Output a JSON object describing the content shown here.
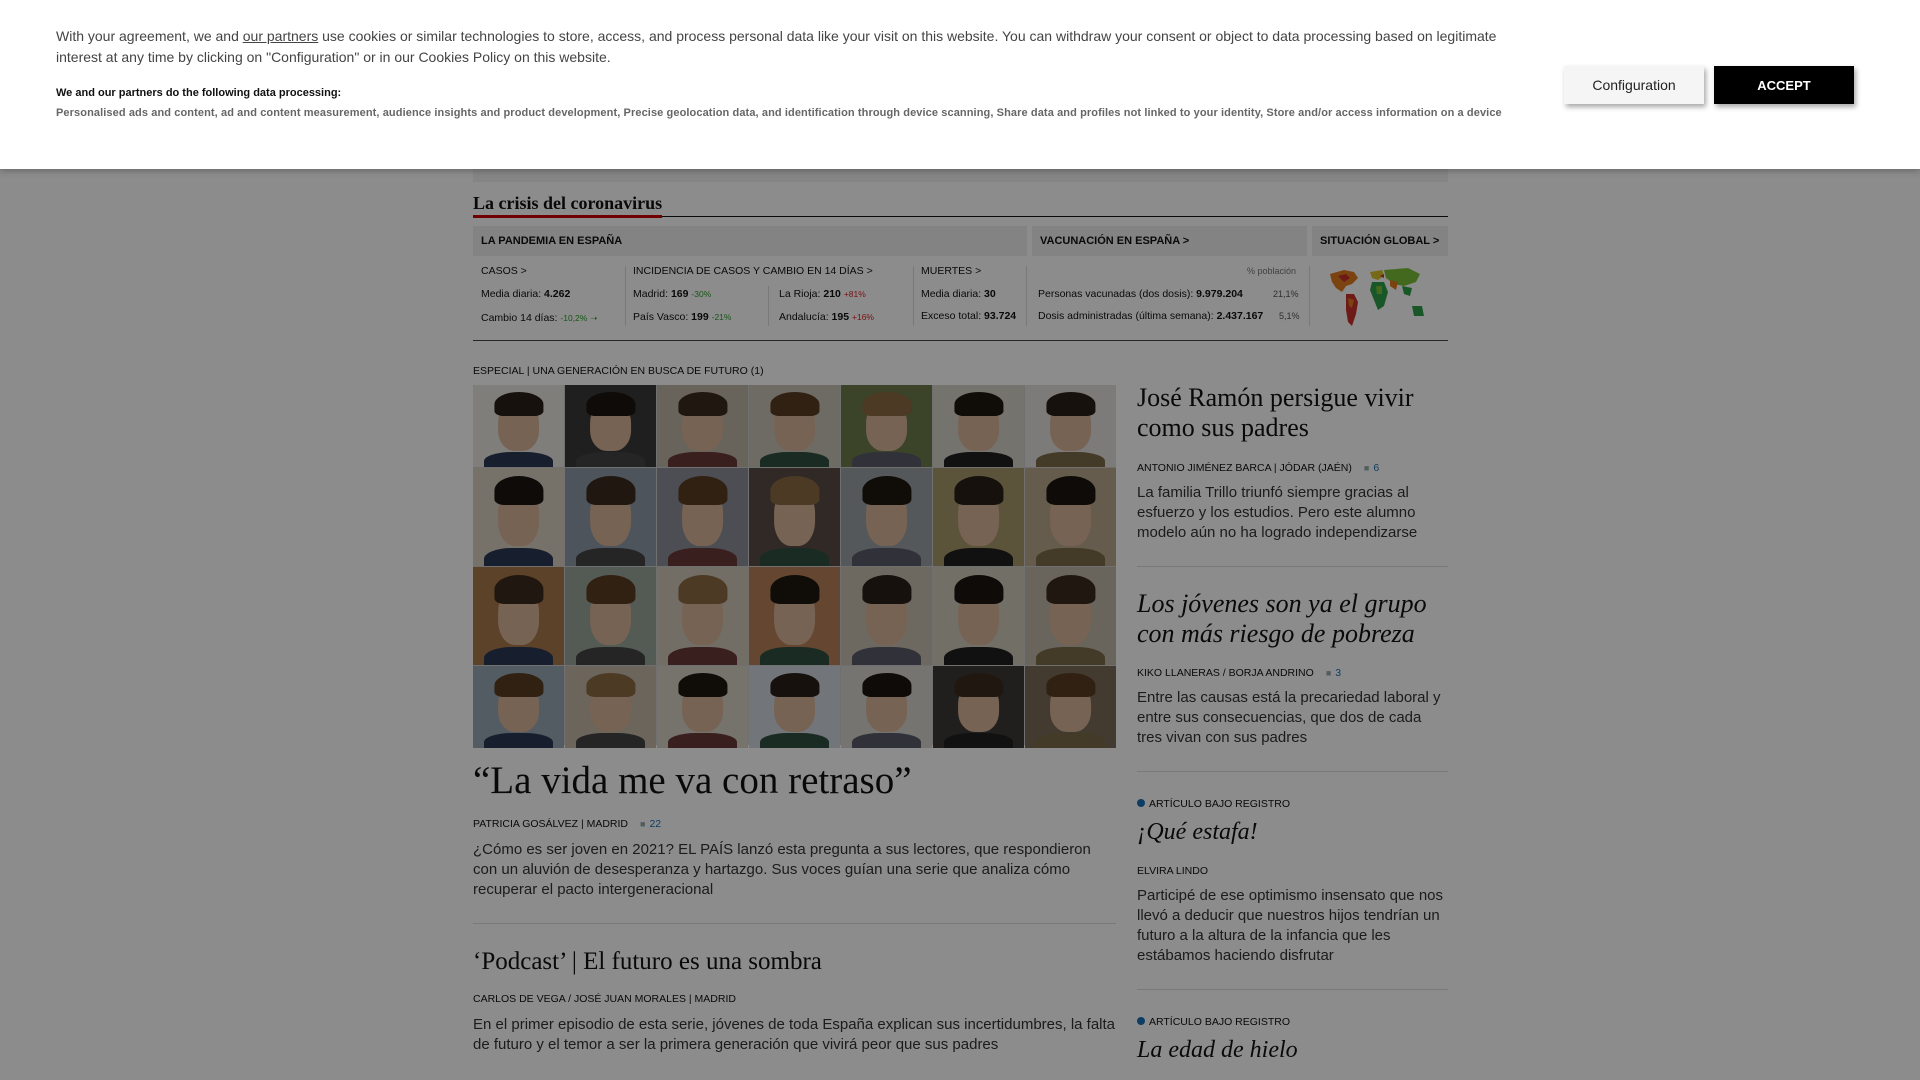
{
  "cookie": {
    "text_before_link": "With your agreement, we and ",
    "partners_link": "our partners",
    "text_after_link": " use cookies or similar technologies to store, access, and process personal data like your visit on this website. You can withdraw your consent or object to data processing based on legitimate interest at any time by clicking on \"Configuration\" or in our Cookies Policy on this website.",
    "subheading": "We and our partners do the following data processing:",
    "purposes": "Personalised ads and content, ad and content measurement, audience insights and product development, Precise geolocation data, and identification through device scanning, Share data and profiles not linked to your identity, Store and/or access information on a device",
    "config_label": "Configuration",
    "accept_label": "ACCEPT"
  },
  "covid": {
    "section_title": "La crisis del coronavirus",
    "tabs": [
      "LA PANDEMIA EN ESPAÑA",
      "VACUNACIÓN EN ESPAÑA >",
      "SITUACIÓN GLOBAL >"
    ],
    "cases": {
      "label": "CASOS >",
      "daily_label": "Media diaria: ",
      "daily_value": "4.262",
      "change_label": "Cambio 14 días: ",
      "change_value": "-10,2%"
    },
    "incidence": {
      "label": "INCIDENCIA DE CASOS Y CAMBIO EN 14 DÍAS >",
      "rows": [
        {
          "name": "Madrid: ",
          "value": "169",
          "change": "-30%",
          "dir": "down"
        },
        {
          "name": "La Rioja: ",
          "value": "210",
          "change": "+81%",
          "dir": "up"
        },
        {
          "name": "País Vasco: ",
          "value": "199",
          "change": "-21%",
          "dir": "down"
        },
        {
          "name": "Andalucía: ",
          "value": "195",
          "change": "+16%",
          "dir": "up"
        }
      ]
    },
    "deaths": {
      "label": "MUERTES >",
      "daily_label": "Media diaria: ",
      "daily_value": "30",
      "excess_label": "Exceso total: ",
      "excess_value": "93.724"
    },
    "vaccination": {
      "pct_header": "% población",
      "vaccinated_label": "Personas vacunadas (dos dosis): ",
      "vaccinated_value": "9.979.204",
      "vaccinated_pct": "21,1%",
      "doses_label": "Dosis administradas (última semana): ",
      "doses_value": "2.437.167",
      "doses_pct": "5,1%"
    }
  },
  "main": {
    "kicker": "ESPECIAL | UNA GENERACIÓN EN BUSCA DE FUTURO (1)",
    "headline": "“La vida me va con retraso”",
    "byline": "PATRICIA GOSÁLVEZ | Madrid",
    "comments": "22",
    "summary": "¿Cómo es ser joven en 2021? EL PAÍS lanzó esta pregunta a sus lectores, que respondieron con un aluvión de desesperanza y hartazgo. Sus voces guían una serie que analiza cómo recuperar el pacto intergeneracional"
  },
  "podcast": {
    "headline": "‘Podcast’ | El futuro es una sombra",
    "byline": "CARLOS DE VEGA /  JOSÉ JUAN MORALES | Madrid",
    "summary": "En el primer episodio de esta serie, jóvenes de toda España explican sus incertidumbres, la falta de futuro y el temor a ser la primera generación que vivirá peor que sus padres"
  },
  "side": [
    {
      "headline": "José Ramón persigue vivir como sus padres",
      "byline": "ANTONIO JIMÉNEZ BARCA | Jódar (Jaén)",
      "comments": "6",
      "summary": "La familia Trillo triunfó siempre gracias al esfuerzo y los estudios. Pero este alumno modelo aún no ha logrado independizarse"
    },
    {
      "headline": "Los jóvenes son ya el grupo con más riesgo de pobreza",
      "byline": "KIKO LLANERAS /  BORJA ANDRINO",
      "comments": "3",
      "summary": "Entre las causas está la precariedad laboral y entre sus consecuencias, que dos de cada tres vivan con sus padres"
    },
    {
      "kicker": "ARTÍCULO BAJO REGISTRO",
      "headline": "¡Qué estafa!",
      "byline": "ELVIRA LINDO",
      "summary": "Participé de ese optimismo insensato que nos llevó a deducir que nuestros hijos tendrían un futuro a la altura de la infancia que les estábamos haciendo disfrutar"
    },
    {
      "kicker": "ARTÍCULO BAJO REGISTRO",
      "headline": "La edad de hielo"
    }
  ],
  "colors": {
    "accept_bg": "#000000",
    "section_underline": "#cc0000",
    "comment_count": "#1b6fb5",
    "pct_down": "#2a9d2a",
    "pct_up": "#dd2222"
  }
}
